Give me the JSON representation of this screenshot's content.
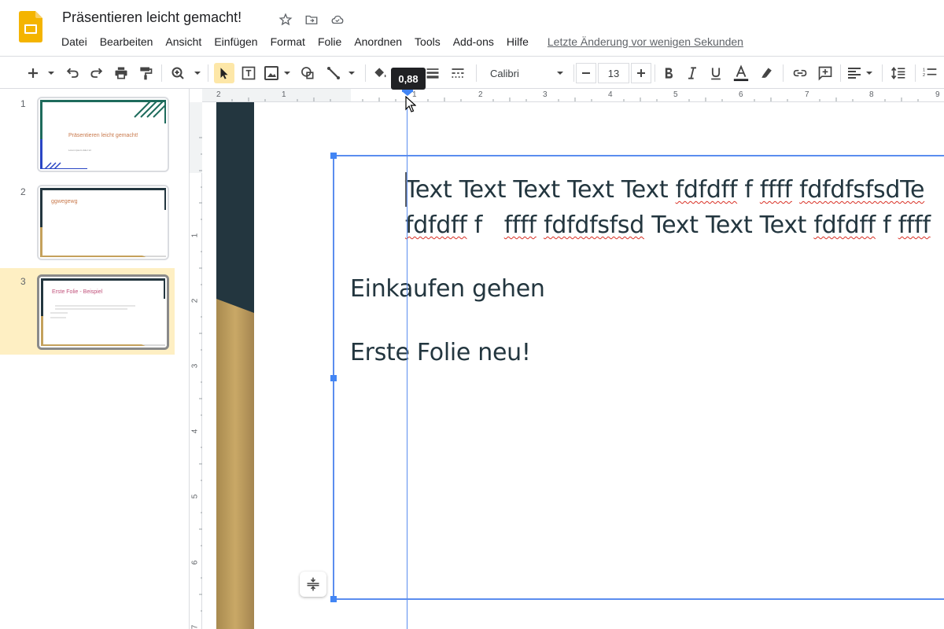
{
  "document": {
    "title": "Präsentieren leicht gemacht!",
    "last_edit": "Letzte Änderung vor wenigen Sekunden"
  },
  "menu": [
    "Datei",
    "Bearbeiten",
    "Ansicht",
    "Einfügen",
    "Format",
    "Folie",
    "Anordnen",
    "Tools",
    "Add-ons",
    "Hilfe"
  ],
  "toolbar": {
    "font": "Calibri",
    "font_size": "13",
    "tooltip": "0,88"
  },
  "slides": [
    {
      "number": "1",
      "title": "Präsentieren leicht gemacht!",
      "subtitle": "Lorem ipsum dolor sit",
      "selected": false
    },
    {
      "number": "2",
      "title": "ggwegewg",
      "selected": false
    },
    {
      "number": "3",
      "title": "Erste Folie - Beispiel",
      "selected": true
    }
  ],
  "rulers": {
    "horizontal": [
      "2",
      "1",
      "1",
      "2",
      "3",
      "4",
      "5",
      "6",
      "7",
      "8",
      "9"
    ],
    "vertical": [
      "1",
      "2",
      "3",
      "4",
      "5",
      "6",
      "7"
    ]
  },
  "slide_content": {
    "line1_plain": "Text Text Text Text Text ",
    "line1_spell1": "fdfdff",
    "line1_mid": " f ",
    "line1_spell2": "ffff",
    "line1_sp": " ",
    "line1_spell3": "fdfdfsfsdTe",
    "line2_spell1": "fdfdff",
    "line2_mid": " f   ",
    "line2_spell2": "ffff",
    "line2_sp": " ",
    "line2_spell3": "fdfdfsfsd",
    "line2_plain": " Text Text Text ",
    "line2_spell4": "fdfdff",
    "line2_mid2": " f ",
    "line2_spell5": "ffff",
    "paragraph2": "Einkaufen gehen",
    "paragraph3": "Erste Folie neu!"
  },
  "colors": {
    "accent_blue": "#4285f4",
    "dark_stripe": "#23363f",
    "gold_stripe": "#c4a15c",
    "selected_slide": "#feefc3"
  }
}
